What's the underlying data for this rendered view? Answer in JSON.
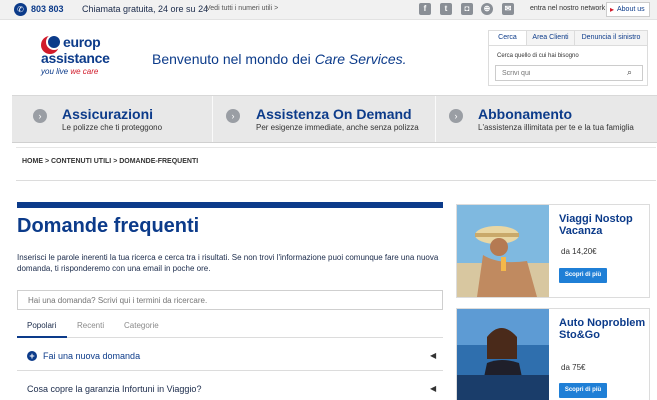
{
  "topbar": {
    "phone_number": "803 803",
    "phone_note": "Chiamata gratuita, 24 ore su 24",
    "numbers_link": "Vedi tutti i numeri utili >",
    "social_icons": [
      "facebook-icon",
      "twitter-icon",
      "instagram-icon",
      "globe-icon",
      "mail-icon"
    ],
    "network_link": "entra nel nostro network",
    "about_label": "About us"
  },
  "header": {
    "logo_line1": "europ",
    "logo_line2": "assistance",
    "logo_tag_a": "you live ",
    "logo_tag_b": "we care",
    "welcome_prefix": "Benvenuto nel mondo dei ",
    "welcome_emphasis": "Care Services."
  },
  "search_panel": {
    "tabs": [
      "Cerca",
      "Area Clienti",
      "Denuncia il sinistro"
    ],
    "active_tab": "Cerca",
    "hint": "Cerca quello di cui hai bisogno",
    "placeholder": "Scrivi qui"
  },
  "nav": {
    "items": [
      {
        "title": "Assicurazioni",
        "subtitle": "Le polizze che ti proteggono"
      },
      {
        "title": "Assistenza On Demand",
        "subtitle": "Per esigenze immediate, anche senza polizza"
      },
      {
        "title": "Abbonamento",
        "subtitle": "L'assistenza illimitata per te e la tua famiglia"
      }
    ]
  },
  "breadcrumb": "HOME  >  CONTENUTI UTILI  >  DOMANDE-FREQUENTI",
  "main": {
    "title": "Domande frequenti",
    "description": "Inserisci le parole inerenti la tua ricerca e cerca tra i risultati. Se non trovi l'informazione puoi comunque fare una nuova domanda, ti risponderemo con una email in poche ore.",
    "question_placeholder": "Hai una domanda? Scrivi qui i termini da ricercare.",
    "filter_tabs": [
      "Popolari",
      "Recenti",
      "Categorie"
    ],
    "active_filter": "Popolari",
    "new_question_label": "Fai una nuova domanda",
    "faq_items": [
      "Cosa copre la garanzia Infortuni in Viaggio?"
    ]
  },
  "promos": [
    {
      "title": "Viaggi Nostop Vacanza",
      "price": "da 14,20€",
      "button": "Scopri di più"
    },
    {
      "title": "Auto Noproblem Sto&Go",
      "price": "da 75€",
      "button": "Scopri di più"
    }
  ],
  "colors": {
    "brand_blue": "#0c3b8a",
    "brand_red": "#d11a2a",
    "cta_blue": "#1f7fd6"
  }
}
